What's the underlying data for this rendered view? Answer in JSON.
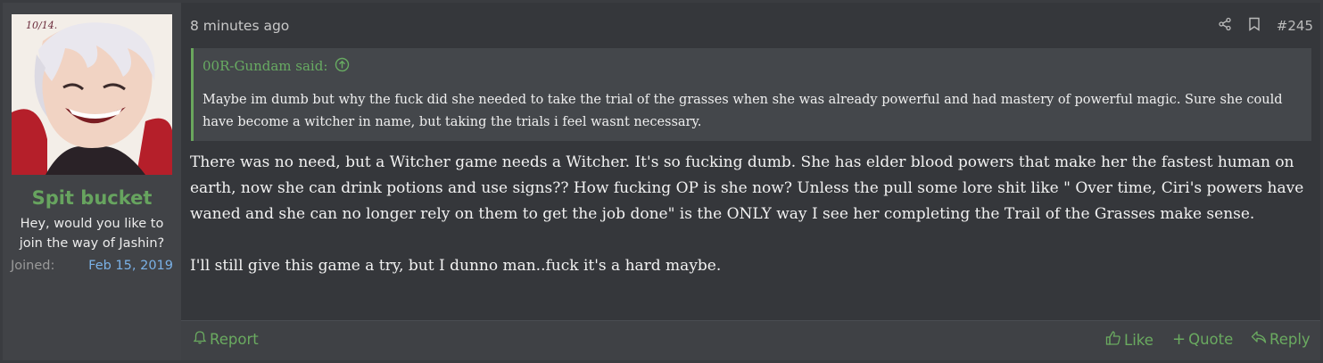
{
  "user": {
    "name": "Spit bucket",
    "title": "Hey, would you like to join the way of Jashin?",
    "joined_label": "Joined:",
    "joined_value": "Feb 15, 2019",
    "avatar_signature": "10/14."
  },
  "post": {
    "time": "8 minutes ago",
    "number": "#245",
    "quote": {
      "author_line": "00R-Gundam said:",
      "text": "Maybe im dumb but why the fuck did she needed to take the trial of the grasses when she was already powerful and had mastery of powerful magic. Sure she could have become a witcher in name, but taking the trials i feel wasnt necessary."
    },
    "paragraphs": [
      "There was no need, but a Witcher game needs a Witcher. It's so fucking dumb. She has elder blood powers that make her the fastest human on earth, now she can drink potions and use signs?? How fucking OP is she now? Unless the pull some lore shit like \" Over time, Ciri's powers have waned and she can no longer rely on them to get the job done\" is the ONLY way I see her completing the Trail of the Grasses make sense.",
      "I'll still give this game a try, but I dunno man..fuck it's a hard maybe."
    ]
  },
  "footer": {
    "report": "Report",
    "like": "Like",
    "quote": "Quote",
    "reply": "Reply"
  },
  "colors": {
    "accent_green": "#67a45f",
    "link_blue": "#7ab1e6",
    "background": "#35373b"
  }
}
